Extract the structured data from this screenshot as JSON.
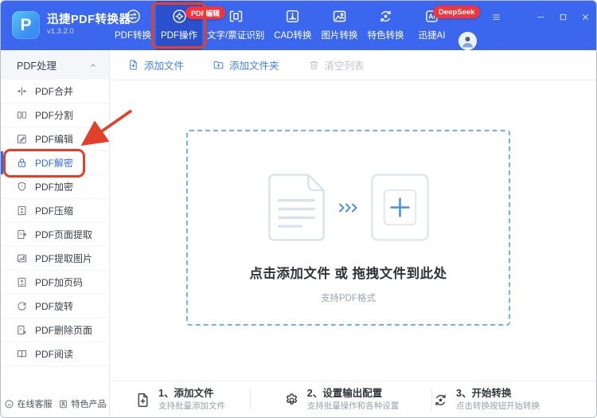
{
  "app": {
    "title": "迅捷PDF转换器",
    "version": "v1.3.2.0",
    "logo_letter": "P"
  },
  "colors": {
    "topbar": "#3a67ed",
    "tab-active": "#2b50cb",
    "accent": "#3568ef",
    "toolbar-blue": "#3f80ee",
    "anno": "#e2402a",
    "badge": "#f5333c"
  },
  "titlebar": {
    "controls": [
      {
        "name": "menu-button",
        "icon": "hamburger-icon"
      },
      {
        "name": "divider",
        "icon": "divider"
      },
      {
        "name": "minimize-button",
        "icon": "minimize-icon"
      },
      {
        "name": "maximize-button",
        "icon": "maximize-icon"
      },
      {
        "name": "close-button",
        "icon": "close-icon"
      }
    ]
  },
  "badges": {
    "pdf_edit": "PDF编辑",
    "deepseek": "DeepSeek"
  },
  "nav": {
    "items": [
      {
        "name": "pdf-convert",
        "label": "PDF转换",
        "icon": "convert-icon"
      },
      {
        "name": "pdf-operate",
        "label": "PDF操作",
        "icon": "operate-icon",
        "selected": true
      },
      {
        "name": "ocr-recognition",
        "label": "文字/票证识别",
        "icon": "ocr-icon"
      },
      {
        "name": "cad-convert",
        "label": "CAD转换",
        "icon": "cad-icon"
      },
      {
        "name": "image-convert",
        "label": "图片转换",
        "icon": "image-icon"
      },
      {
        "name": "special-convert",
        "label": "特色转换",
        "icon": "star-cycle-icon"
      },
      {
        "name": "xunjie-ai",
        "label": "迅捷AI",
        "icon": "ai-icon"
      }
    ]
  },
  "toolbar": {
    "buttons": [
      {
        "name": "add-file-button",
        "label": "添加文件",
        "icon": "file-plus-icon"
      },
      {
        "name": "add-folder-button",
        "label": "添加文件夹",
        "icon": "folder-plus-icon"
      },
      {
        "name": "clear-list-button",
        "label": "清空列表",
        "icon": "trash-icon",
        "disabled": true
      }
    ]
  },
  "sidebar": {
    "header": {
      "label": "PDF处理",
      "collapse_icon": "chevron-up-icon"
    },
    "items": [
      {
        "name": "pdf-merge",
        "label": "PDF合并",
        "icon": "merge-icon"
      },
      {
        "name": "pdf-split",
        "label": "PDF分割",
        "icon": "split-icon"
      },
      {
        "name": "pdf-edit",
        "label": "PDF编辑",
        "icon": "edit-icon"
      },
      {
        "name": "pdf-decrypt",
        "label": "PDF解密",
        "icon": "lock-icon",
        "selected": true
      },
      {
        "name": "pdf-encrypt",
        "label": "PDF加密",
        "icon": "shield-icon"
      },
      {
        "name": "pdf-compress",
        "label": "PDF压缩",
        "icon": "compress-icon"
      },
      {
        "name": "pdf-page-extract",
        "label": "PDF页面提取",
        "icon": "page-extract-icon"
      },
      {
        "name": "pdf-image-extract",
        "label": "PDF提取图片",
        "icon": "image-icon"
      },
      {
        "name": "pdf-page-number",
        "label": "PDF加页码",
        "icon": "page-number-icon"
      },
      {
        "name": "pdf-rotate",
        "label": "PDF旋转",
        "icon": "rotate-icon"
      },
      {
        "name": "pdf-delete-page",
        "label": "PDF删除页面",
        "icon": "page-delete-icon"
      },
      {
        "name": "pdf-read",
        "label": "PDF阅读",
        "icon": "book-icon"
      }
    ],
    "footer": [
      {
        "name": "online-service",
        "label": "在线客服",
        "icon": "service-icon"
      },
      {
        "name": "featured-products",
        "label": "特色产品",
        "icon": "product-icon"
      }
    ]
  },
  "dropzone": {
    "main_text": "点击添加文件 或 拖拽文件到此处",
    "sub_text": "支持PDF格式"
  },
  "steps": {
    "items": [
      {
        "name": "step-1-add-files",
        "title": "1、添加文件",
        "subtitle": "支持批量添加文件",
        "icon": "file-plus-icon"
      },
      {
        "name": "step-2-set-output",
        "title": "2、设置输出配置",
        "subtitle": "支持批量操作和各种设置",
        "icon": "gear-icon"
      },
      {
        "name": "step-3-start-convert",
        "title": "3、开始转换",
        "subtitle": "点击转换按钮开始转换",
        "icon": "star-cycle-icon"
      }
    ]
  }
}
